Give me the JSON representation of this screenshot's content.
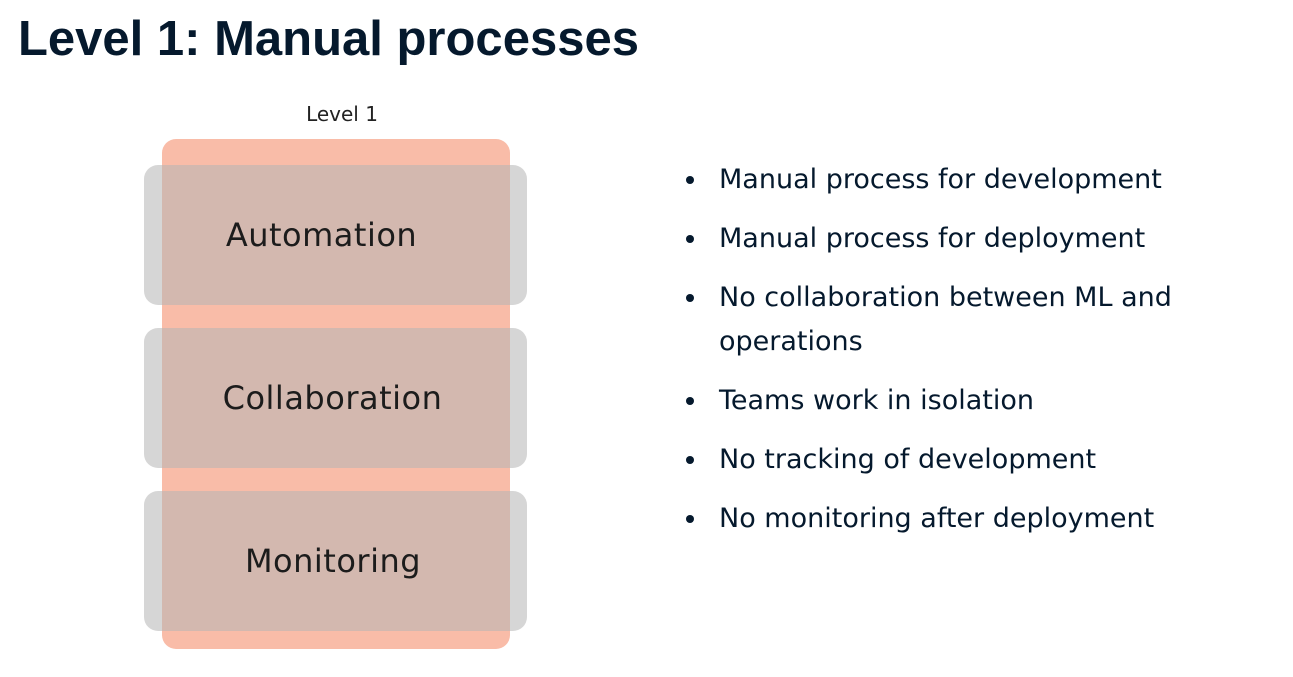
{
  "slide": {
    "title": "Level 1: Manual processes"
  },
  "diagram": {
    "column_label": "Level 1",
    "rows": [
      {
        "label": "Automation"
      },
      {
        "label": "Collaboration"
      },
      {
        "label": "Monitoring"
      }
    ],
    "colors": {
      "level_column": "#f9bca8",
      "row_overlay": "#b4b4b4"
    }
  },
  "bullets": [
    "Manual process for development",
    "Manual process for deployment",
    "No collaboration between ML and operations",
    "Teams work in isolation",
    "No tracking of development",
    "No monitoring after deployment"
  ]
}
